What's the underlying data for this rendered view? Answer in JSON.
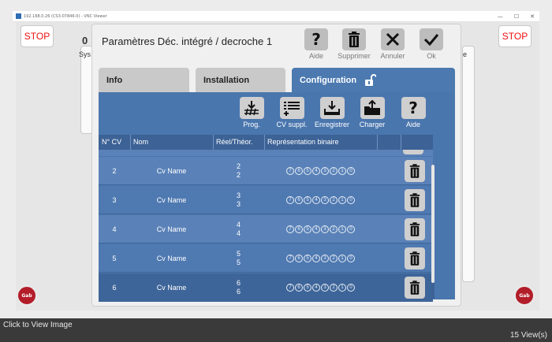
{
  "window": {
    "title": "192.168.0.26 (CS3-07846-0) - VNC Viewer",
    "controls": [
      "—",
      "☐",
      "✕"
    ]
  },
  "background": {
    "stop_label": "STOP",
    "left_fragment_top": "0",
    "left_fragment_bottom": "Sys",
    "right_fragment": "e",
    "badge_label": "Gab"
  },
  "dialog": {
    "title": "Paramètres Déc. intégré / decroche 1",
    "toolbar": {
      "help_label": "Aide",
      "delete_label": "Supprimer",
      "cancel_label": "Annuler",
      "ok_label": "Ok"
    },
    "tabs": [
      {
        "label": "Info"
      },
      {
        "label": "Installation"
      },
      {
        "label": "Configuration"
      }
    ],
    "subtoolbar": {
      "prog_label": "Prog.",
      "cv_suppl_label": "CV suppl.",
      "save_label": "Enregistrer",
      "load_label": "Charger",
      "help_label": "Aide"
    },
    "table": {
      "columns": [
        "N° CV",
        "Nom",
        "Réel/Théor.",
        "Représentation binaire"
      ],
      "bit_labels": [
        "7",
        "6",
        "5",
        "4",
        "3",
        "2",
        "1",
        "0"
      ],
      "rows": [
        {
          "cv": "2",
          "name": "Cv Name",
          "real": "2",
          "theor": "2"
        },
        {
          "cv": "3",
          "name": "Cv Name",
          "real": "3",
          "theor": "3"
        },
        {
          "cv": "4",
          "name": "Cv Name",
          "real": "4",
          "theor": "4"
        },
        {
          "cv": "5",
          "name": "Cv Name",
          "real": "5",
          "theor": "5"
        },
        {
          "cv": "6",
          "name": "Cv Name",
          "real": "6",
          "theor": "6"
        }
      ]
    }
  },
  "footer": {
    "click_to_view": "Click to View Image",
    "views": "15 View(s)"
  },
  "colors": {
    "tab_active": "#4b79b0",
    "content_bg": "#4a76ae",
    "header_bg": "#3c6296",
    "stop_red": "#ee1111",
    "badge_red": "#b31d2a"
  },
  "icons": {
    "help": "question-mark",
    "delete": "trash",
    "cancel": "x-mark",
    "ok": "check-mark",
    "lock": "padlock-unlocked",
    "prog": "download-to-track",
    "cv_suppl": "list-plus",
    "save": "tray-download",
    "load": "folder-open"
  }
}
